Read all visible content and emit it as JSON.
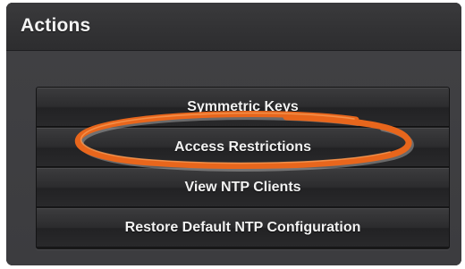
{
  "panel": {
    "title": "Actions"
  },
  "actions": [
    {
      "label": "Symmetric Keys"
    },
    {
      "label": "Access Restrictions"
    },
    {
      "label": "View NTP Clients"
    },
    {
      "label": "Restore Default NTP Configuration"
    }
  ],
  "annotation": {
    "highlighted_action": "Access Restrictions",
    "color": "#e8661c"
  }
}
